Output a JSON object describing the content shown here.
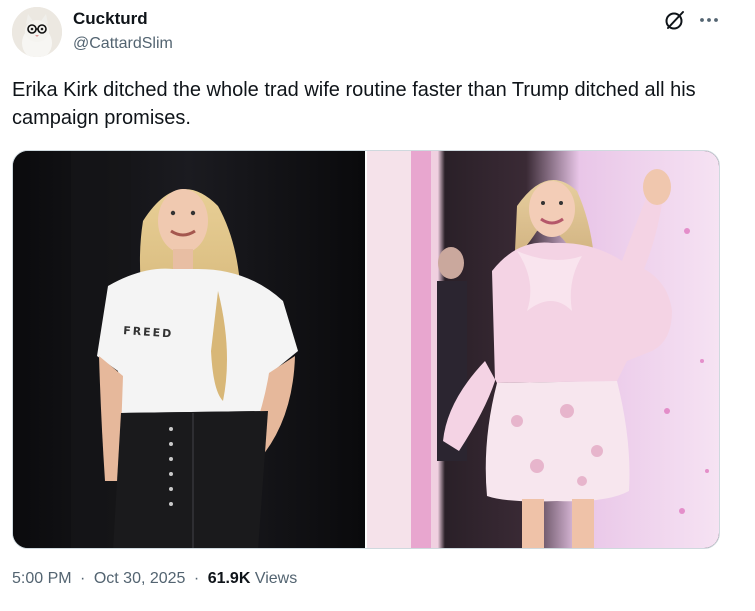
{
  "author": {
    "display_name": "Cuckturd",
    "handle": "@CattardSlim",
    "avatar_icon": "cat-with-glasses-avatar"
  },
  "header_actions": {
    "grok_icon": "grok-slash-circle-icon",
    "more_icon": "more-dots-icon"
  },
  "tweet": {
    "text": "Erika Kirk ditched the whole trad wife routine faster than Trump ditched all his campaign promises."
  },
  "media": {
    "images": [
      {
        "name": "photo-left",
        "shirt_text": "FREED"
      },
      {
        "name": "photo-right"
      }
    ]
  },
  "meta": {
    "time": "5:00 PM",
    "date": "Oct 30, 2025",
    "separator": "·",
    "views_count": "61.9K",
    "views_label": "Views"
  },
  "colors": {
    "text_primary": "#0f1419",
    "text_secondary": "#536471",
    "border": "#cfd9de"
  }
}
